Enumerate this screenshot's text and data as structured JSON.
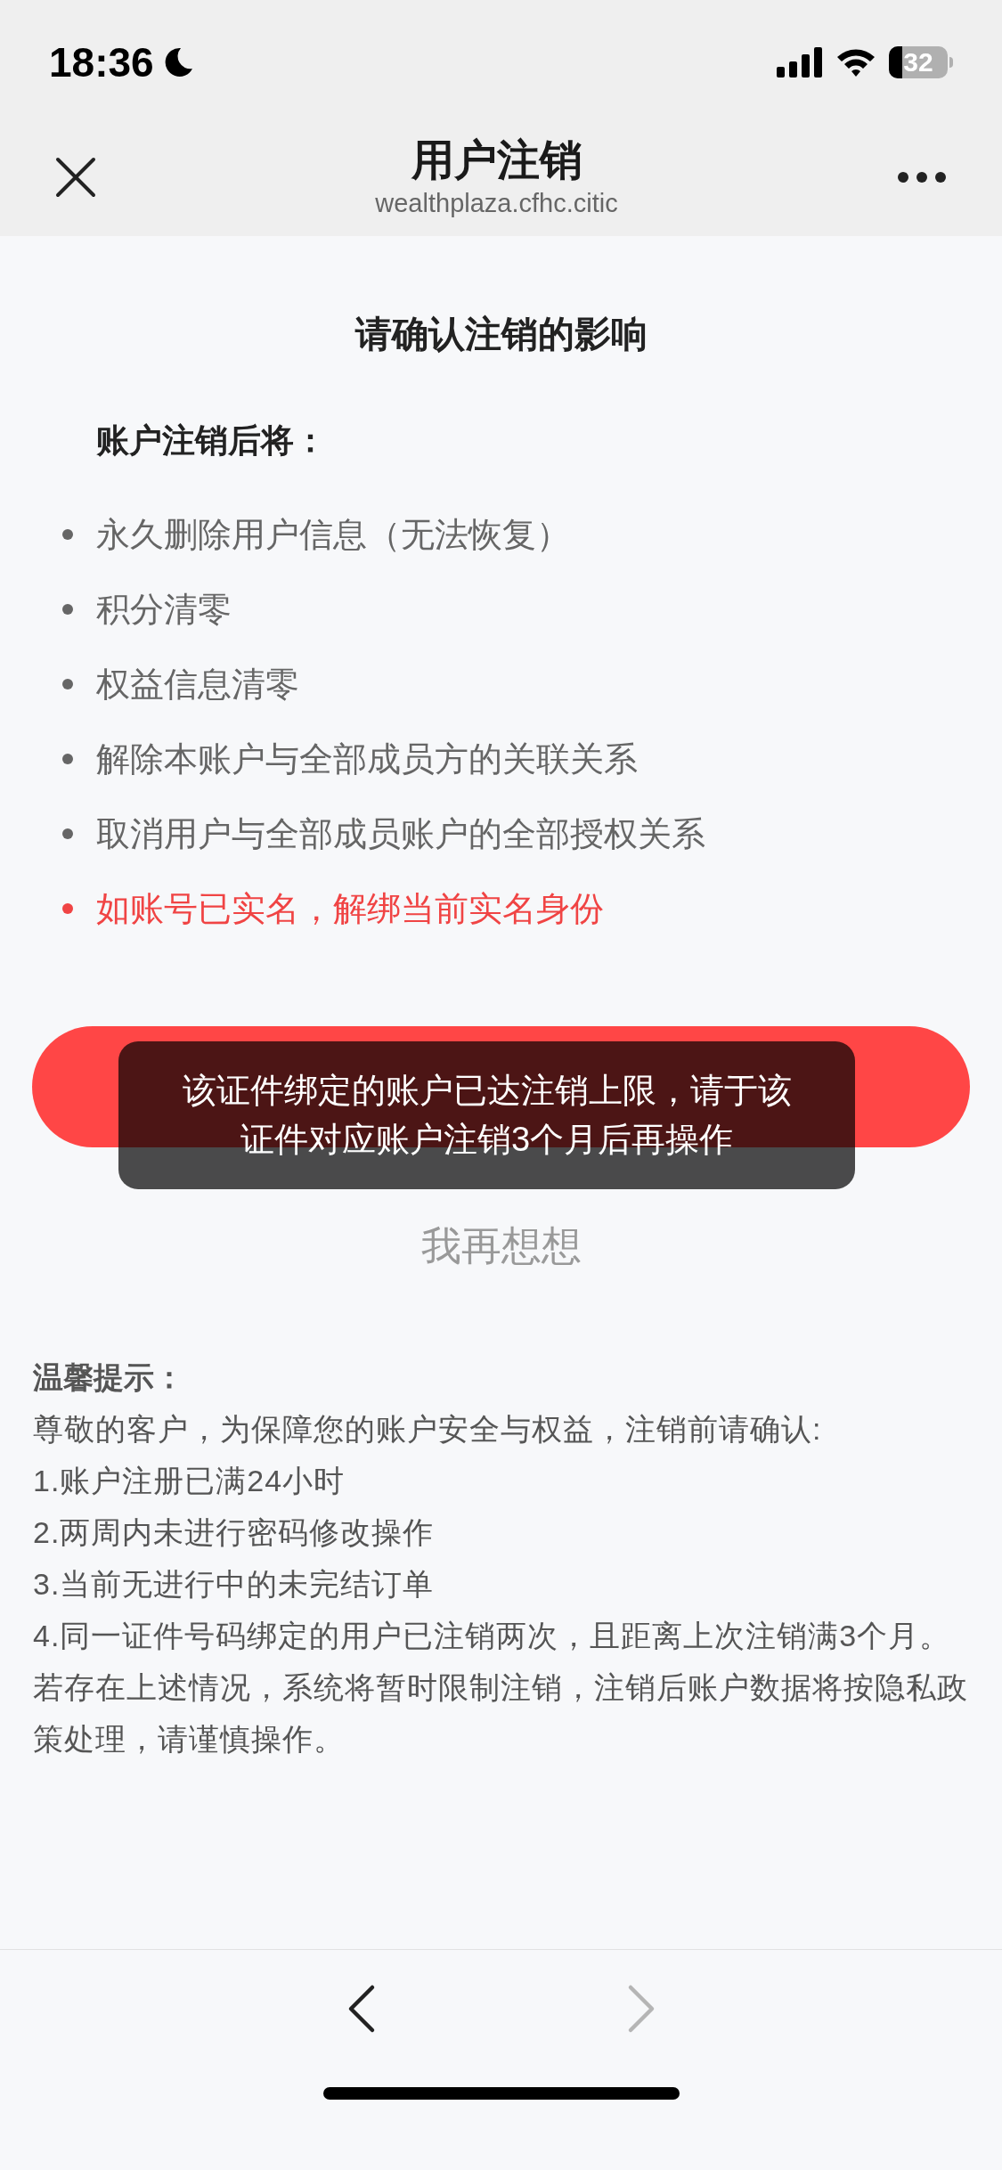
{
  "status_bar": {
    "time": "18:36",
    "battery": "32"
  },
  "nav_bar": {
    "title": "用户注销",
    "subtitle": "wealthplaza.cfhc.citic"
  },
  "heading": "请确认注销的影响",
  "effects": {
    "title": "账户注销后将：",
    "items": [
      {
        "text": "永久删除用户信息（无法恢复）",
        "kind": "normal"
      },
      {
        "text": "积分清零",
        "kind": "normal"
      },
      {
        "text": "权益信息清零",
        "kind": "normal"
      },
      {
        "text": "解除本账户与全部成员方的关联关系",
        "kind": "normal"
      },
      {
        "text": "取消用户与全部成员账户的全部授权关系",
        "kind": "normal"
      },
      {
        "text": "如账号已实名，解绑当前实名身份",
        "kind": "warning"
      }
    ]
  },
  "toast": "该证件绑定的账户已达注销上限，请于该证件对应账户注销3个月后再操作",
  "cancel_button": "我再想想",
  "tips": {
    "title": "温馨提示：",
    "lines": [
      "尊敬的客户，为保障您的账户安全与权益，注销前请确认:",
      "1.账户注册已满24小时",
      "2.两周内未进行密码修改操作",
      "3.当前无进行中的未完结订单",
      "4.同一证件号码绑定的用户已注销两次，且距离上次注销满3个月。若存在上述情况，系统将暂时限制注销，注销后账户数据将按隐私政策处理，请谨慎操作。"
    ]
  },
  "toolbar": {
    "back": {
      "disabled": false
    },
    "forward": {
      "disabled": true
    }
  }
}
